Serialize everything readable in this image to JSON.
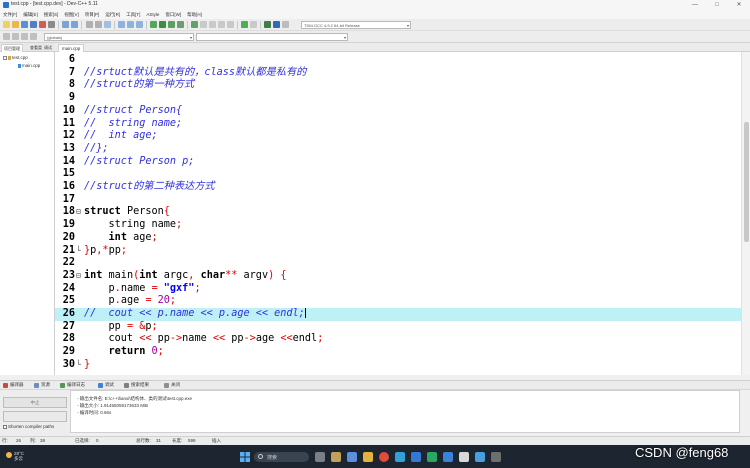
{
  "window": {
    "title": "test.cpp - [test.cpp.dev] - Dev-C++ 5.11",
    "controls": [
      "—",
      "□",
      "✕"
    ]
  },
  "menubar": [
    "文件[F]",
    "编辑[E]",
    "搜索[S]",
    "视图[V]",
    "项目[P]",
    "运行[R]",
    "工具[T]",
    "AStyle",
    "窗口[W]",
    "帮助[H]"
  ],
  "toolbar": {
    "compiler": "TDM-GCC 4.9.2 64-bit Release",
    "scope": "(globals)"
  },
  "left_panel": {
    "tabs": [
      "项目管理",
      "查看类",
      "调试"
    ],
    "project": "test.cpp",
    "file": "main.cpp"
  },
  "editor": {
    "tab": "main.cpp",
    "lines": [
      {
        "n": "6",
        "segs": []
      },
      {
        "n": "7",
        "segs": [
          {
            "c": "c",
            "t": "//srtuct默认是共有的，class默认都是私有的"
          }
        ]
      },
      {
        "n": "8",
        "segs": [
          {
            "c": "c",
            "t": "//struct的第一种方式"
          }
        ]
      },
      {
        "n": "9",
        "segs": []
      },
      {
        "n": "10",
        "segs": [
          {
            "c": "c",
            "t": "//struct Person{"
          }
        ]
      },
      {
        "n": "11",
        "segs": [
          {
            "c": "c",
            "t": "//  string name;"
          }
        ]
      },
      {
        "n": "12",
        "segs": [
          {
            "c": "c",
            "t": "//  int age;"
          }
        ]
      },
      {
        "n": "13",
        "segs": [
          {
            "c": "c",
            "t": "//};"
          }
        ]
      },
      {
        "n": "14",
        "segs": [
          {
            "c": "c",
            "t": "//struct Person p;"
          }
        ]
      },
      {
        "n": "15",
        "segs": []
      },
      {
        "n": "16",
        "segs": [
          {
            "c": "c",
            "t": "//struct的第二种表达方式"
          }
        ]
      },
      {
        "n": "17",
        "segs": []
      },
      {
        "n": "18",
        "fold": "⊟",
        "segs": [
          {
            "c": "k",
            "t": "struct"
          },
          {
            "c": "t",
            "t": " Person"
          },
          {
            "c": "r",
            "t": "{"
          }
        ]
      },
      {
        "n": "19",
        "segs": [
          {
            "c": "t",
            "t": "    string name"
          },
          {
            "c": "r",
            "t": ";"
          }
        ]
      },
      {
        "n": "20",
        "segs": [
          {
            "c": "t",
            "t": "    "
          },
          {
            "c": "k",
            "t": "int"
          },
          {
            "c": "t",
            "t": " age"
          },
          {
            "c": "r",
            "t": ";"
          }
        ]
      },
      {
        "n": "21",
        "fold": "└",
        "segs": [
          {
            "c": "r",
            "t": "}"
          },
          {
            "c": "t",
            "t": "p"
          },
          {
            "c": "r",
            "t": ",*"
          },
          {
            "c": "t",
            "t": "pp"
          },
          {
            "c": "r",
            "t": ";"
          }
        ]
      },
      {
        "n": "22",
        "segs": []
      },
      {
        "n": "23",
        "fold": "⊟",
        "segs": [
          {
            "c": "k",
            "t": "int"
          },
          {
            "c": "t",
            "t": " main"
          },
          {
            "c": "r",
            "t": "("
          },
          {
            "c": "k",
            "t": "int"
          },
          {
            "c": "t",
            "t": " argc"
          },
          {
            "c": "r",
            "t": ", "
          },
          {
            "c": "k",
            "t": "char"
          },
          {
            "c": "r",
            "t": "**"
          },
          {
            "c": "t",
            "t": " argv"
          },
          {
            "c": "r",
            "t": ") {"
          }
        ]
      },
      {
        "n": "24",
        "segs": [
          {
            "c": "t",
            "t": "    p"
          },
          {
            "c": "r",
            "t": "."
          },
          {
            "c": "t",
            "t": "name "
          },
          {
            "c": "r",
            "t": "= "
          },
          {
            "c": "s",
            "t": "\"gxf\""
          },
          {
            "c": "r",
            "t": ";"
          }
        ]
      },
      {
        "n": "25",
        "segs": [
          {
            "c": "t",
            "t": "    p"
          },
          {
            "c": "r",
            "t": "."
          },
          {
            "c": "t",
            "t": "age "
          },
          {
            "c": "r",
            "t": "= "
          },
          {
            "c": "n",
            "t": "20"
          },
          {
            "c": "r",
            "t": ";"
          }
        ]
      },
      {
        "n": "26",
        "hl": true,
        "segs": [
          {
            "c": "c",
            "t": "//  cout << p.name << p.age << endl;"
          }
        ]
      },
      {
        "n": "27",
        "segs": [
          {
            "c": "t",
            "t": "    pp "
          },
          {
            "c": "r",
            "t": "= &"
          },
          {
            "c": "t",
            "t": "p"
          },
          {
            "c": "r",
            "t": ";"
          }
        ]
      },
      {
        "n": "28",
        "segs": [
          {
            "c": "t",
            "t": "    cout "
          },
          {
            "c": "r",
            "t": "<<"
          },
          {
            "c": "t",
            "t": " pp"
          },
          {
            "c": "r",
            "t": "->"
          },
          {
            "c": "t",
            "t": "name "
          },
          {
            "c": "r",
            "t": "<<"
          },
          {
            "c": "t",
            "t": " pp"
          },
          {
            "c": "r",
            "t": "->"
          },
          {
            "c": "t",
            "t": "age "
          },
          {
            "c": "r",
            "t": "<<"
          },
          {
            "c": "t",
            "t": "endl"
          },
          {
            "c": "r",
            "t": ";"
          }
        ]
      },
      {
        "n": "29",
        "segs": [
          {
            "c": "t",
            "t": "    "
          },
          {
            "c": "k",
            "t": "return"
          },
          {
            "c": "t",
            "t": " "
          },
          {
            "c": "n",
            "t": "0"
          },
          {
            "c": "r",
            "t": ";"
          }
        ]
      },
      {
        "n": "30",
        "fold": "└",
        "segs": [
          {
            "c": "r",
            "t": "}"
          }
        ]
      }
    ]
  },
  "bottom_panel": {
    "tabs": [
      "编译器",
      "资源",
      "编译日志",
      "调试",
      "搜索结果",
      "关闭"
    ],
    "abort_button": "中止",
    "shorten_paths_label": "Shorten compiler paths",
    "log": [
      "- 输出文件名: E:\\c++\\lianxi\\结构体、类的测试\\test.cpp.exe",
      "- 输出大小: 1.91455059173633 MiB",
      "- 编译时间: 0.66s"
    ]
  },
  "statusbar": {
    "line_label": "行:",
    "line_value": "26",
    "col_label": "列:",
    "col_value": "38",
    "sel_label": "已选择:",
    "sel_value": "0",
    "total_label": "总行数:",
    "total_value": "31",
    "len_label": "长度:",
    "len_value": "599",
    "mode": "插入"
  },
  "taskbar": {
    "temperature": "28°C",
    "weather": "多云",
    "search_placeholder": "搜索"
  },
  "watermark": "CSDN @feng68"
}
